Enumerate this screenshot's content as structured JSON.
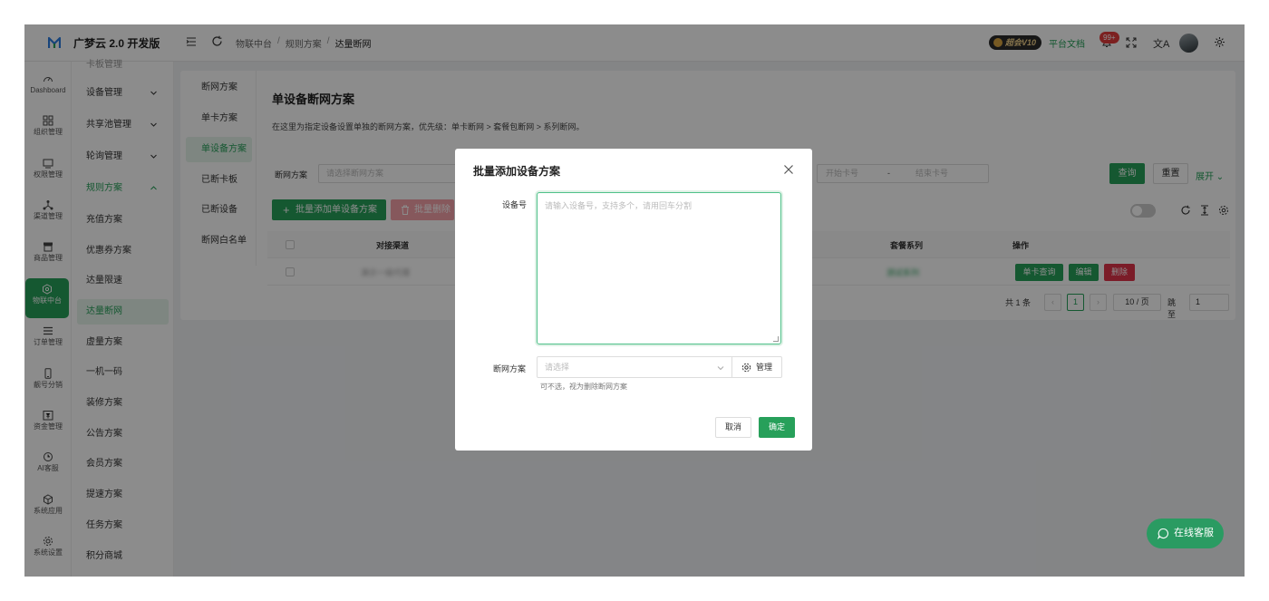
{
  "header": {
    "brand": "广梦云 2.0 开发版",
    "breadcrumb": [
      "物联中台",
      "规则方案",
      "达量断网"
    ],
    "vip_badge": "超会V10",
    "docs_link": "平台文档",
    "notification_count": "99+",
    "lang_icon": "文A"
  },
  "rail": {
    "items": [
      {
        "label": "Dashboard",
        "icon": "dashboard-icon"
      },
      {
        "label": "组织管理",
        "icon": "grid-icon"
      },
      {
        "label": "权限管理",
        "icon": "monitor-icon"
      },
      {
        "label": "渠道管理",
        "icon": "network-icon"
      },
      {
        "label": "商品管理",
        "icon": "store-icon"
      },
      {
        "label": "物联中台",
        "icon": "hexagon-icon",
        "active": true
      },
      {
        "label": "订单管理",
        "icon": "list-icon"
      },
      {
        "label": "靓号分销",
        "icon": "phone-icon"
      },
      {
        "label": "资金管理",
        "icon": "yuan-icon"
      },
      {
        "label": "AI客服",
        "icon": "ai-clock-icon"
      },
      {
        "label": "系统应用",
        "icon": "cube-icon"
      },
      {
        "label": "系统设置",
        "icon": "gear-icon"
      }
    ]
  },
  "submenu": {
    "cut_item": "卡板管理",
    "items": [
      {
        "label": "设备管理",
        "chevron": "down"
      },
      {
        "label": "共享池管理",
        "chevron": "down"
      },
      {
        "label": "轮询管理",
        "chevron": "down"
      },
      {
        "label": "规则方案",
        "chevron": "up",
        "open": true
      },
      {
        "label": "充值方案"
      },
      {
        "label": "优惠券方案"
      },
      {
        "label": "达量限速"
      },
      {
        "label": "达量断网",
        "active": true
      },
      {
        "label": "虚量方案"
      },
      {
        "label": "一机一码"
      },
      {
        "label": "装修方案"
      },
      {
        "label": "公告方案"
      },
      {
        "label": "会员方案"
      },
      {
        "label": "提速方案"
      },
      {
        "label": "任务方案"
      },
      {
        "label": "积分商城"
      }
    ]
  },
  "scheme_tabs": [
    {
      "label": "断网方案"
    },
    {
      "label": "单卡方案"
    },
    {
      "label": "单设备方案",
      "active": true
    },
    {
      "label": "已断卡板"
    },
    {
      "label": "已断设备"
    },
    {
      "label": "断网白名单"
    }
  ],
  "page": {
    "heading": "单设备断网方案",
    "description": "在这里为指定设备设置单独的断网方案，优先级：单卡断网 > 套餐包断网 > 系列断网。",
    "filter_label": "断网方案",
    "filter_placeholder": "请选择断网方案",
    "card_start_placeholder": "开始卡号",
    "card_range_dash": "-",
    "card_end_placeholder": "结束卡号",
    "query_label": "查询",
    "reset_label": "重置",
    "expand_label": "展开",
    "add_label": "批量添加单设备方案",
    "batch_delete_label": "批量删除"
  },
  "table": {
    "headers": {
      "channel": "对接渠道",
      "series": "套餐系列",
      "actions": "操作"
    },
    "rows": [
      {
        "channel_blurred": "演示一级代理",
        "series_blurred": "测试系列",
        "actions": [
          "单卡查询",
          "编辑",
          "删除"
        ]
      }
    ]
  },
  "pagination": {
    "total": "共 1 条",
    "prev": "‹",
    "current": "1",
    "next": "›",
    "page_size": "10 / 页",
    "goto_label": "跳至",
    "goto_value": "1"
  },
  "chat_fab": {
    "label": "在线客服"
  },
  "dialog": {
    "title": "批量添加设备方案",
    "device_label": "设备号",
    "device_placeholder": "请输入设备号，支持多个，请用回车分割",
    "scheme_label": "断网方案",
    "scheme_placeholder": "请选择",
    "manage_label": "管理",
    "hint": "可不选，视为删除断网方案",
    "cancel_label": "取消",
    "ok_label": "确定"
  },
  "colors": {
    "primary": "#27a05a",
    "danger": "#e0334a",
    "overlay": "rgba(0,0,0,0.45)"
  }
}
